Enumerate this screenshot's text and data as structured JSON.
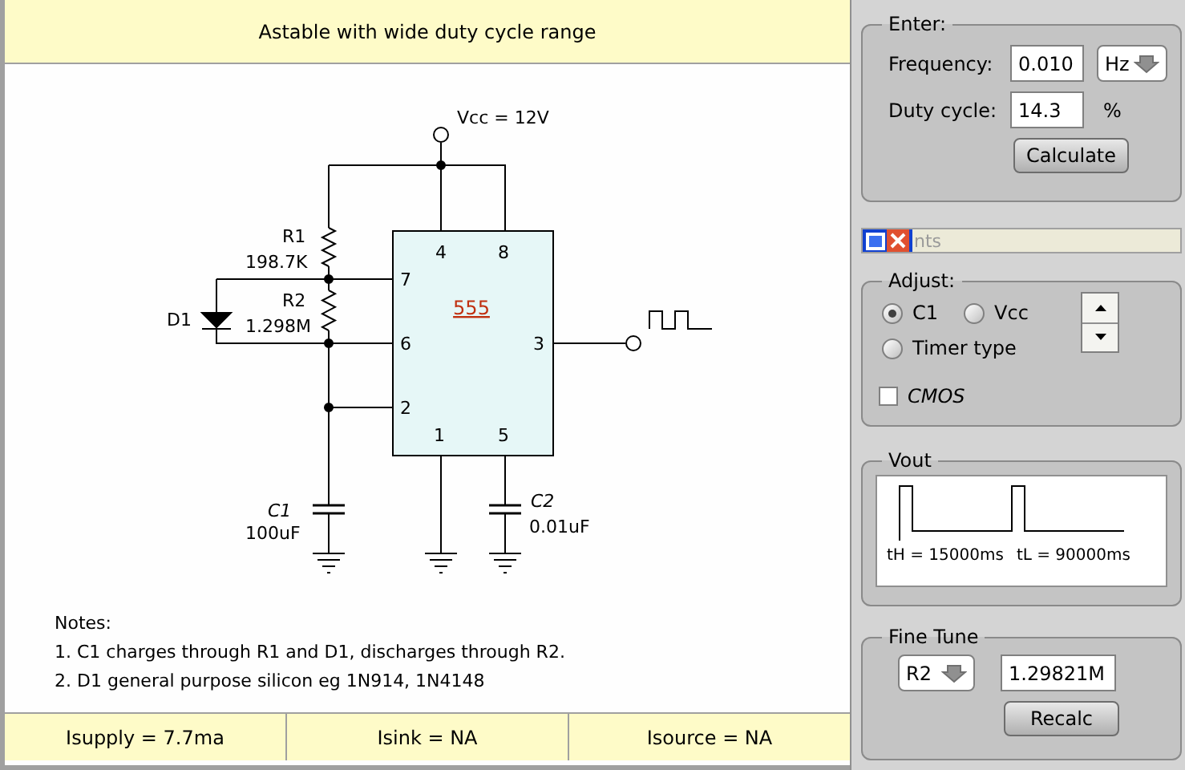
{
  "title": "Astable with wide duty cycle range",
  "schematic": {
    "supply_label": "Vcc = 12V",
    "chip_label": "555",
    "pins": [
      "4",
      "8",
      "7",
      "6",
      "3",
      "2",
      "1",
      "5"
    ],
    "components": [
      {
        "name": "R1",
        "value": "198.7K"
      },
      {
        "name": "D1"
      },
      {
        "name": "R2",
        "value": "1.298M"
      },
      {
        "name": "C1",
        "value": "100uF"
      },
      {
        "name": "C2",
        "value": "0.01uF"
      }
    ]
  },
  "notes": [
    "Notes:",
    "1. C1 charges through R1 and D1, discharges through R2.",
    "2. D1 general purpose silicon eg 1N914, 1N4148"
  ],
  "status_bar": [
    "Isupply =  7.7ma",
    "Isink = NA",
    "Isource = NA"
  ],
  "enter": {
    "title": "Enter:",
    "frequency_label": "Frequency:",
    "frequency": "0.010",
    "unit": "Hz",
    "duty_label": "Duty cycle:",
    "duty": "14.3",
    "duty_unit": "%",
    "button": "Calculate"
  },
  "mini_bar": {
    "text": "nts"
  },
  "adjust": {
    "title": "Adjust:",
    "options": [
      {
        "label": "C1",
        "selected": true
      },
      {
        "label": "Vcc",
        "selected": false
      },
      {
        "label": "Timer type",
        "selected": false
      }
    ],
    "cmos": {
      "label": "CMOS",
      "checked": false
    }
  },
  "vout": {
    "title": "Vout",
    "th": "tH = 15000ms",
    "tl": "tL = 90000ms"
  },
  "fine_tune": {
    "title": "Fine Tune",
    "component": "R2",
    "value": "1.29821M",
    "button": "Recalc"
  }
}
